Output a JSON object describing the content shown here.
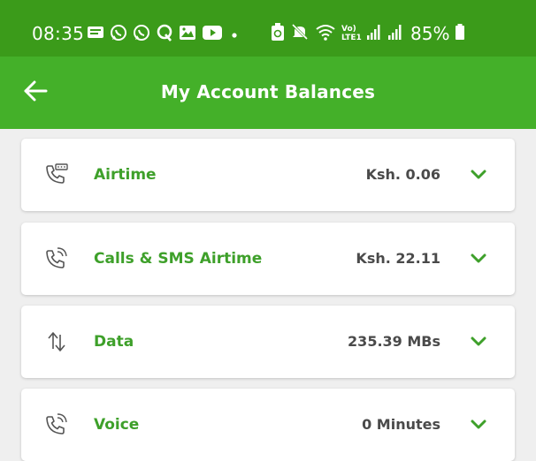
{
  "status_bar": {
    "time": "08:35",
    "battery": "85%",
    "network_label": "Vo) LTE1"
  },
  "app_bar": {
    "title": "My Account Balances",
    "back_icon": "arrow-left-icon"
  },
  "balances": [
    {
      "label": "Airtime",
      "value": "Ksh. 0.06",
      "icon": "phone-dial-icon"
    },
    {
      "label": "Calls & SMS Airtime",
      "value": "Ksh. 22.11",
      "icon": "phone-call-icon"
    },
    {
      "label": "Data",
      "value": "235.39 MBs",
      "icon": "data-transfer-icon"
    },
    {
      "label": "Voice",
      "value": "0 Minutes",
      "icon": "phone-call-icon"
    }
  ],
  "colors": {
    "status_bar": "#3b9b1a",
    "app_bar": "#44b029",
    "accent_green": "#3ea02a",
    "background": "#efefef",
    "card": "#ffffff",
    "value_text": "#4a4a4a"
  }
}
